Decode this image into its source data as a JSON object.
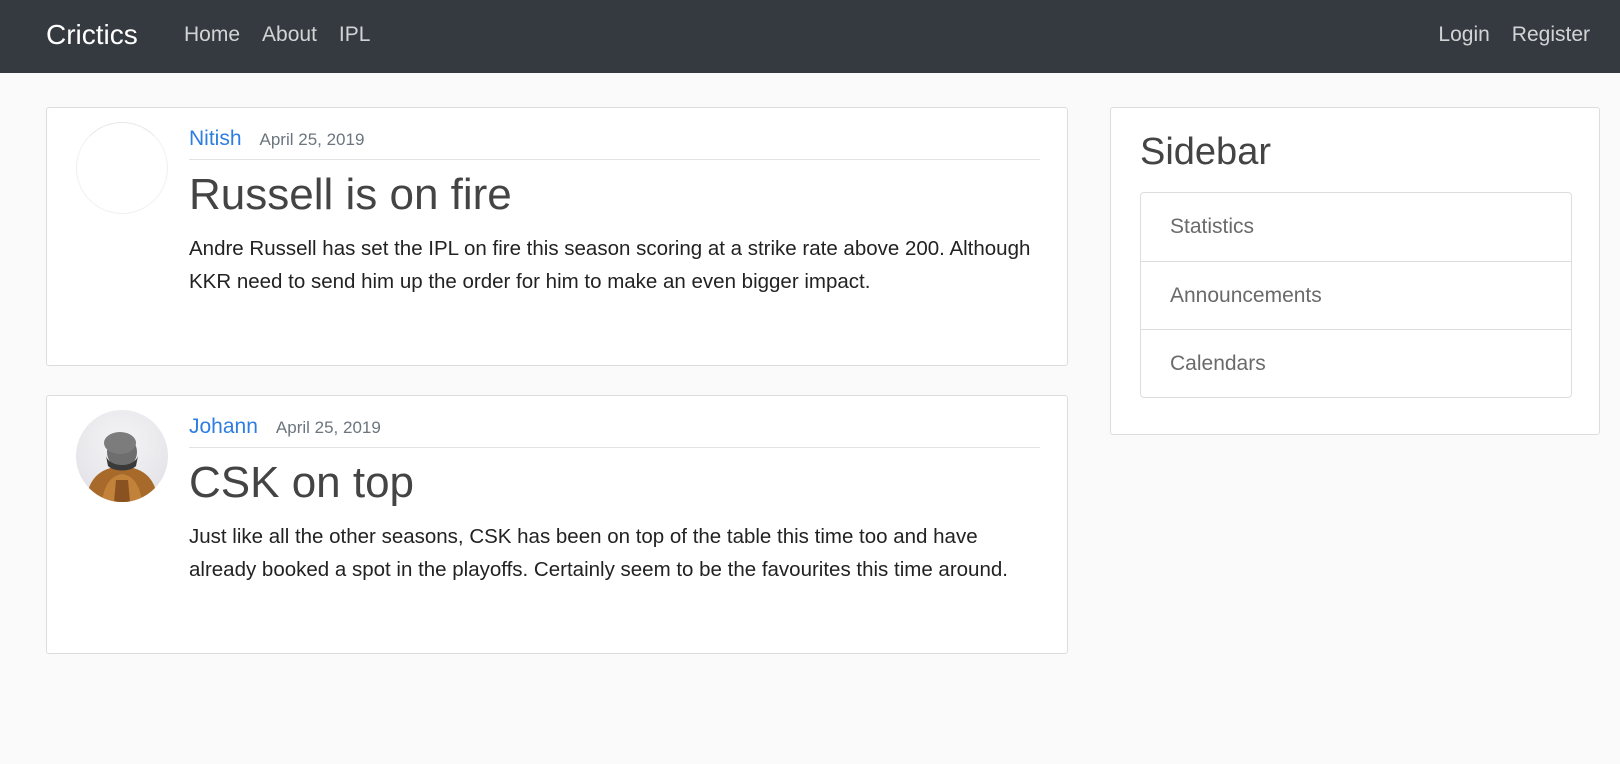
{
  "navbar": {
    "brand": "Crictics",
    "left_links": [
      "Home",
      "About",
      "IPL"
    ],
    "right_links": [
      "Login",
      "Register"
    ]
  },
  "posts": [
    {
      "author": "Nitish",
      "date": "April 25, 2019",
      "title": "Russell is on fire",
      "body": "Andre Russell has set the IPL on fire this season scoring at a strike rate above 200. Although KKR need to send him up the order for him to make an even bigger impact."
    },
    {
      "author": "Johann",
      "date": "April 25, 2019",
      "title": "CSK on top",
      "body": "Just like all the other seasons, CSK has been on top of the table this time too and have already booked a spot in the playoffs. Certainly seem to be the favourites this time around."
    }
  ],
  "sidebar": {
    "heading": "Sidebar",
    "items": [
      "Statistics",
      "Announcements",
      "Calendars"
    ]
  }
}
